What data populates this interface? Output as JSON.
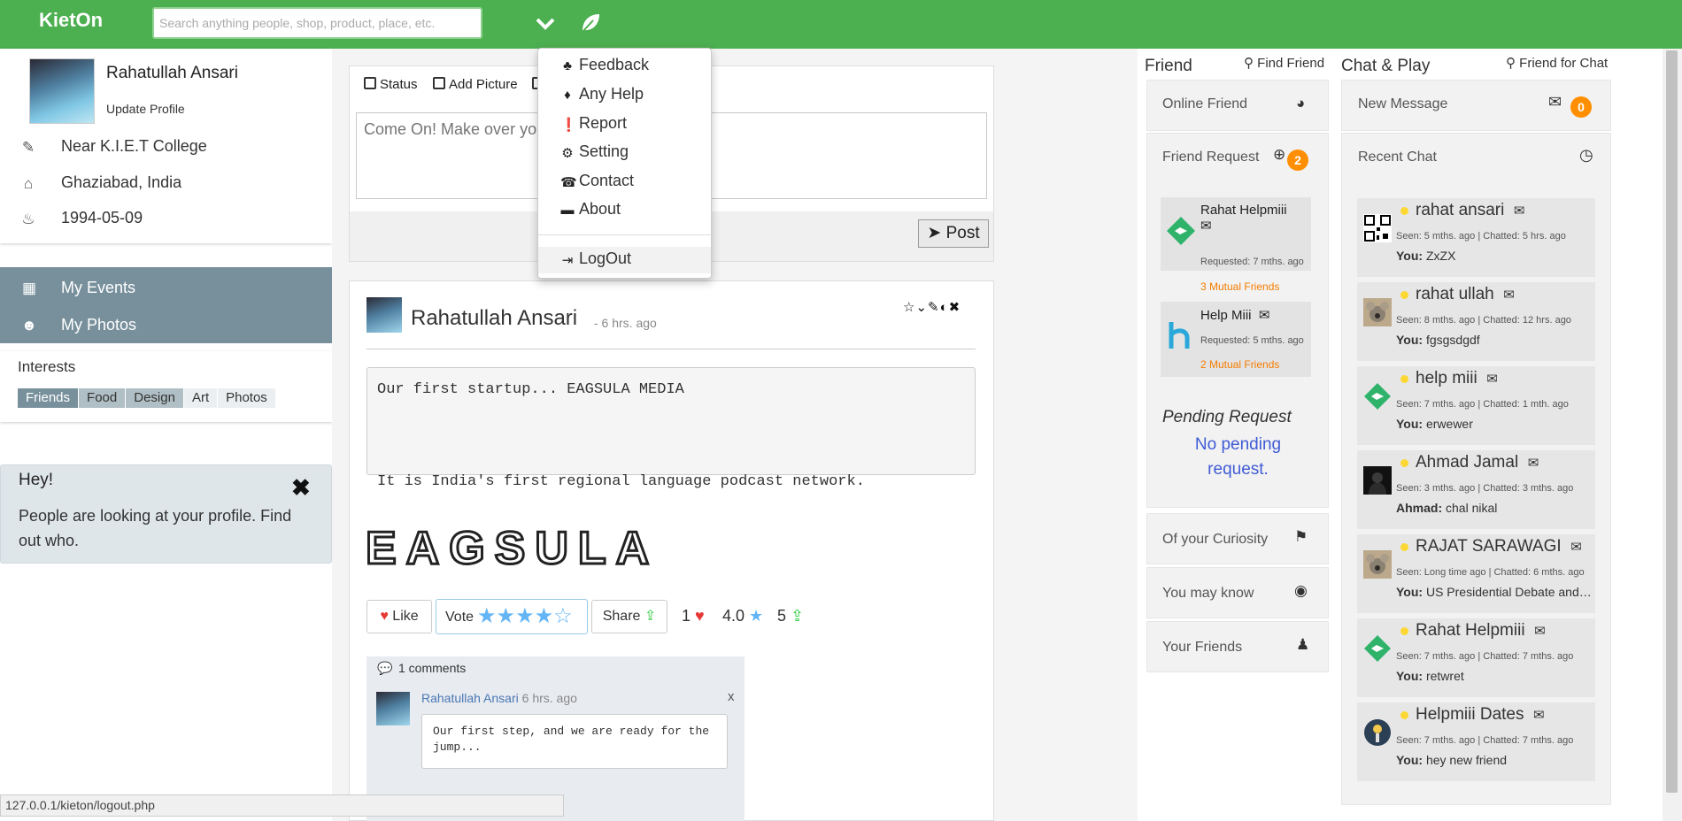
{
  "brand": "KietOn",
  "search": {
    "placeholder": "Search anything people, shop, product, place, etc."
  },
  "profile": {
    "name": "Rahatullah Ansari",
    "update_label": "Update Profile",
    "location": "Near K.I.E.T College",
    "city": "Ghaziabad, India",
    "dob": "1994-05-09"
  },
  "menu": {
    "events": "My Events",
    "photos": "My Photos"
  },
  "interests": {
    "title": "Interests",
    "tags": [
      "Friends",
      "Food",
      "Design",
      "Art",
      "Photos"
    ]
  },
  "hey": {
    "title": "Hey!",
    "text": "People are looking at your profile. Find out who."
  },
  "composer": {
    "tabs": [
      "Status",
      "Add Picture"
    ],
    "placeholder": "Come On! Make over your thoughts into words...",
    "post_label": "Post"
  },
  "dropdown": {
    "items": [
      "Feedback",
      "Any Help",
      "Report",
      "Setting",
      "Contact",
      "About"
    ],
    "logout": "LogOut"
  },
  "post": {
    "author": "Rahatullah Ansari",
    "time": "- 6 hrs. ago",
    "line1": "Our first startup... EAGSULA MEDIA",
    "line2": "It is India's first regional language podcast network.",
    "logo_text": "EAGSULA",
    "like_label": "Like",
    "vote_label": "Vote",
    "share_label": "Share",
    "likes": "1",
    "rating": "4.0",
    "shares": "5",
    "comments": {
      "count_label": "1 comments",
      "author": "Rahatullah Ansari",
      "time": "6 hrs. ago",
      "close": "x",
      "body": "Our first step, and we are ready for the jump..."
    }
  },
  "friend": {
    "title": "Friend",
    "find_label": "Find Friend",
    "online": "Online Friend",
    "request": "Friend Request",
    "request_count": "2",
    "requests": [
      {
        "name": "Rahat Helpmiii",
        "time": "Requested: 7 mths. ago",
        "mutual": "3 Mutual Friends"
      },
      {
        "name": "Help Miii",
        "time": "Requested: 5 mths. ago",
        "mutual": "2 Mutual Friends"
      }
    ],
    "pending_title": "Pending Request",
    "pending_text": "No pending request.",
    "curiosity": "Of your Curiosity",
    "may_know": "You may know",
    "your_friends": "Your Friends"
  },
  "chat": {
    "title": "Chat & Play",
    "find_label": "Friend for Chat",
    "new_message": "New Message",
    "new_count": "0",
    "recent": "Recent Chat",
    "items": [
      {
        "name": "rahat ansari",
        "seen": "Seen: 5 mths. ago | Chatted: 5 hrs. ago",
        "who": "You:",
        "msg": "ZxZX",
        "avatar": "qr"
      },
      {
        "name": "rahat ullah",
        "seen": "Seen: 8 mths. ago | Chatted: 12 hrs. ago",
        "who": "You:",
        "msg": "fgsgsdgdf",
        "avatar": "koala"
      },
      {
        "name": "help miii",
        "seen": "Seen: 7 mths. ago | Chatted: 1 mth. ago",
        "who": "You:",
        "msg": "erwewer",
        "avatar": "green"
      },
      {
        "name": "Ahmad Jamal",
        "seen": "Seen: 3 mths. ago | Chatted: 3 mths. ago",
        "who": "Ahmad:",
        "msg": "chal nikal",
        "avatar": "dark"
      },
      {
        "name": "RAJAT SARAWAGI",
        "seen": "Seen: Long time ago | Chatted: 6 mths. ago",
        "who": "You:",
        "msg": "US Presidential Debate android app",
        "avatar": "koala"
      },
      {
        "name": "Rahat Helpmiii",
        "seen": "Seen: 7 mths. ago | Chatted: 7 mths. ago",
        "who": "You:",
        "msg": "retwret",
        "avatar": "green"
      },
      {
        "name": "Helpmiii Dates",
        "seen": "Seen: 7 mths. ago | Chatted: 7 mths. ago",
        "who": "You:",
        "msg": "hey new friend",
        "avatar": "lamp"
      }
    ]
  },
  "status_url": "127.0.0.1/kieton/logout.php",
  "colors": {
    "topbar": "#4caf50",
    "menu": "#78909c",
    "badge": "#ff8f00",
    "link": "#3f5bd6"
  }
}
